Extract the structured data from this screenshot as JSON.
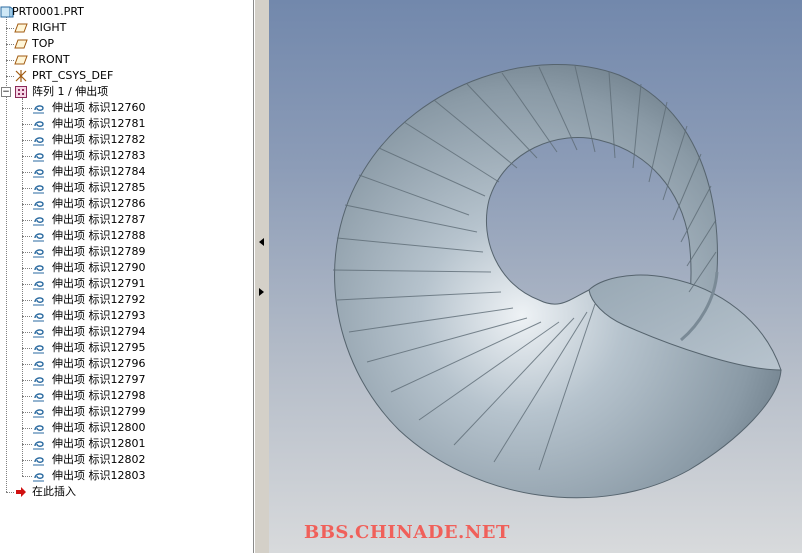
{
  "model_tree": {
    "root": "PRT0001.PRT",
    "datum_planes": [
      "RIGHT",
      "TOP",
      "FRONT"
    ],
    "csys": "PRT_CSYS_DEF",
    "pattern": "阵列 1 / 伸出项",
    "extrusions": [
      "伸出项 标识12760",
      "伸出项 标识12781",
      "伸出项 标识12782",
      "伸出项 标识12783",
      "伸出项 标识12784",
      "伸出项 标识12785",
      "伸出项 标识12786",
      "伸出项 标识12787",
      "伸出项 标识12788",
      "伸出项 标识12789",
      "伸出项 标识12790",
      "伸出项 标识12791",
      "伸出项 标识12792",
      "伸出项 标识12793",
      "伸出项 标识12794",
      "伸出项 标识12795",
      "伸出项 标识12796",
      "伸出项 标识12797",
      "伸出项 标识12798",
      "伸出项 标识12799",
      "伸出项 标识12800",
      "伸出项 标识12801",
      "伸出项 标识12802",
      "伸出项 标识12803"
    ],
    "insert_here": "在此插入"
  },
  "watermark": "BBS.CHINADE.NET",
  "icons": {
    "root": "part-icon",
    "datum_plane": "datum-plane-icon",
    "csys": "csys-icon",
    "pattern": "pattern-icon",
    "extrusion": "extrude-icon",
    "insert": "insert-arrow-icon"
  },
  "colors": {
    "viewport_top": "#7288ac",
    "viewport_bottom": "#d8dadc",
    "model_surface": "#a9b8c3",
    "watermark": "#f0605a",
    "insert_arrow": "#d01010"
  }
}
